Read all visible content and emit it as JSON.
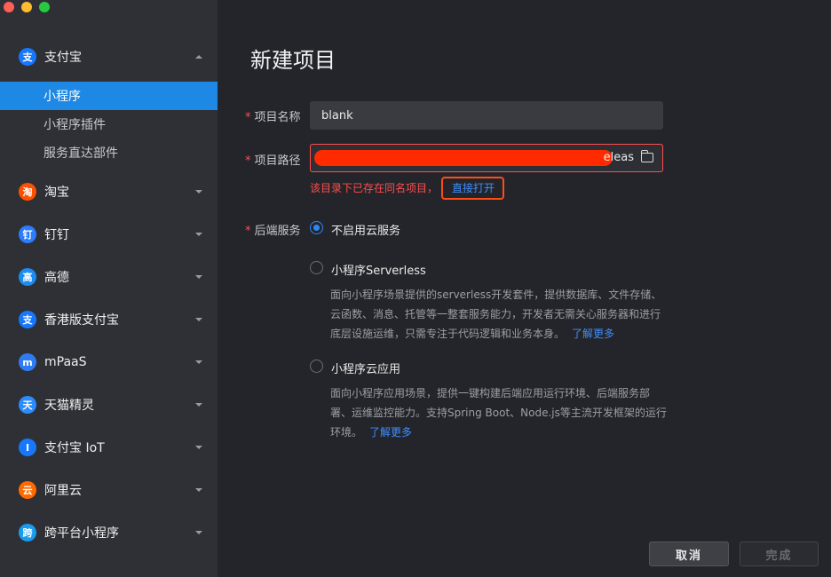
{
  "sidebar": {
    "groups": [
      {
        "label": "支付宝",
        "icon": "alipay-icon",
        "color": "#1677ff",
        "glyph": "支",
        "expanded": true
      },
      {
        "label": "淘宝",
        "icon": "taobao-icon",
        "color": "#ff5000",
        "glyph": "淘"
      },
      {
        "label": "钉钉",
        "icon": "dingtalk-icon",
        "color": "#2b7cff",
        "glyph": "钉"
      },
      {
        "label": "高德",
        "icon": "amap-icon",
        "color": "#1c8bf2",
        "glyph": "高"
      },
      {
        "label": "香港版支付宝",
        "icon": "alipayhk-icon",
        "color": "#1677ff",
        "glyph": "支"
      },
      {
        "label": "mPaaS",
        "icon": "mpaas-icon",
        "color": "#2e7bf6",
        "glyph": "m"
      },
      {
        "label": "天猫精灵",
        "icon": "tmall-genie-icon",
        "color": "#2a8cff",
        "glyph": "天"
      },
      {
        "label": "支付宝 IoT",
        "icon": "alipay-iot-icon",
        "color": "#1677ff",
        "glyph": "I"
      },
      {
        "label": "阿里云",
        "icon": "aliyun-icon",
        "color": "#ff6a00",
        "glyph": "云"
      },
      {
        "label": "跨平台小程序",
        "icon": "cross-platform-icon",
        "color": "#1a9bf0",
        "glyph": "跨"
      }
    ],
    "subitems": [
      {
        "label": "小程序",
        "active": true
      },
      {
        "label": "小程序插件",
        "active": false
      },
      {
        "label": "服务直达部件",
        "active": false
      }
    ]
  },
  "main": {
    "title": "新建项目",
    "name_label": "项目名称",
    "name_value": "blank",
    "path_label": "项目路径",
    "path_tail": "eleas",
    "error_text": "该目录下已存在同名项目，",
    "open_link": "直接打开",
    "backend_label": "后端服务",
    "options": [
      {
        "label": "不启用云服务",
        "checked": true
      },
      {
        "label": "小程序Serverless",
        "checked": false,
        "desc": "面向小程序场景提供的serverless开发套件，提供数据库、文件存储、云函数、消息、托管等一整套服务能力，开发者无需关心服务器和进行底层设施运维，只需专注于代码逻辑和业务本身。",
        "more": "了解更多"
      },
      {
        "label": "小程序云应用",
        "checked": false,
        "desc": "面向小程序应用场景，提供一键构建后端应用运行环境、后端服务部署、运维监控能力。支持Spring Boot、Node.js等主流开发框架的运行环境。",
        "more": "了解更多"
      }
    ],
    "cancel_label": "取消",
    "done_label": "完成"
  }
}
